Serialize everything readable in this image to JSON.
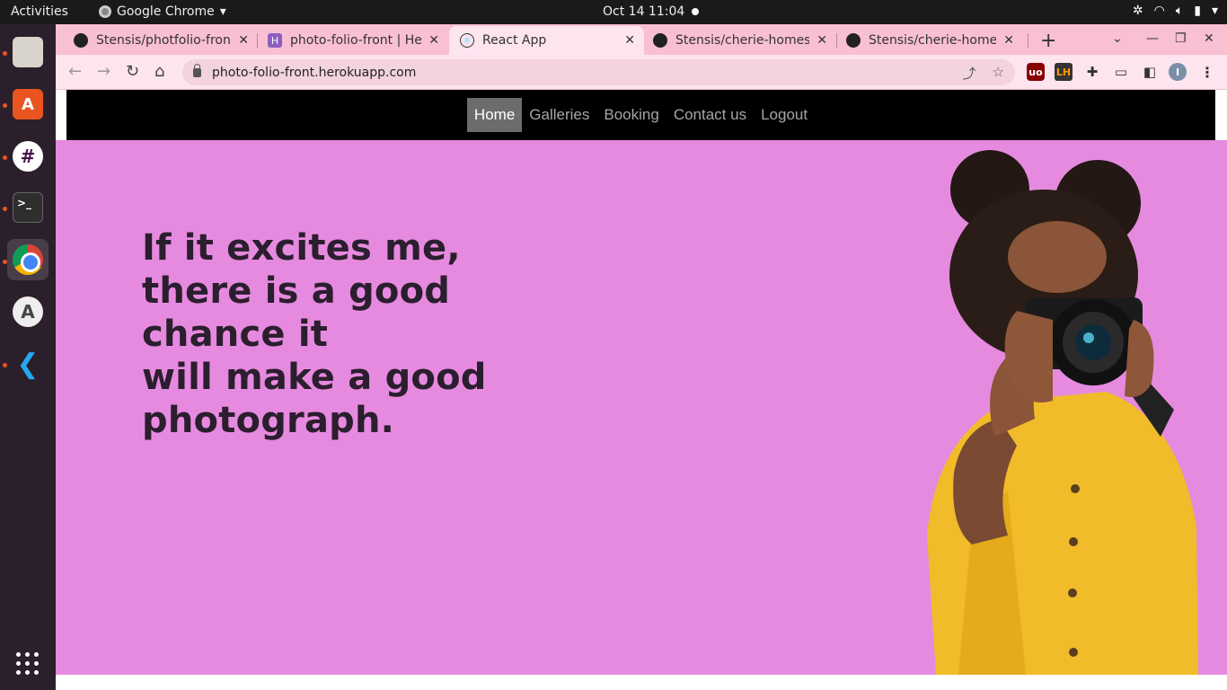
{
  "topbar": {
    "activities": "Activities",
    "app_name": "Google Chrome",
    "clock": "Oct 14  11:04"
  },
  "dock": {
    "apps": [
      "files-icon",
      "software-store-icon",
      "slack-icon",
      "terminal-icon",
      "chrome-icon",
      "software-updater-icon",
      "vscode-icon"
    ]
  },
  "browser": {
    "tabs": [
      {
        "title": "Stensis/photfolio-front",
        "favicon": "github-icon"
      },
      {
        "title": "photo-folio-front | Heroku",
        "favicon": "heroku-icon"
      },
      {
        "title": "React App",
        "favicon": "react-icon"
      },
      {
        "title": "Stensis/cherie-homes-",
        "favicon": "github-icon"
      },
      {
        "title": "Stensis/cherie-homes",
        "favicon": "github-icon"
      }
    ],
    "url": "photo-folio-front.herokuapp.com",
    "profile_initial": "I"
  },
  "site": {
    "nav": [
      "Home",
      "Galleries",
      "Booking",
      "Contact us",
      "Logout"
    ],
    "hero_lines": [
      "If it excites me,",
      "there is a good chance it",
      "will make a good",
      "photograph."
    ],
    "hero_bg": "#e68adf",
    "nav_bg": "#000000"
  }
}
